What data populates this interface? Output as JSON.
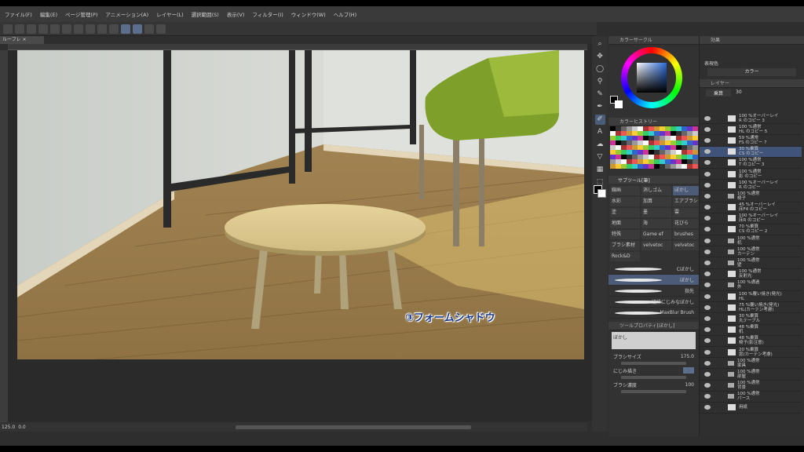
{
  "menu": [
    "ファイル(F)",
    "編集(E)",
    "ページ管理(P)",
    "アニメーション(A)",
    "レイヤー(L)",
    "選択範囲(S)",
    "表示(V)",
    "フィルター(I)",
    "ウィンドウ(W)",
    "ヘルプ(H)"
  ],
  "doc_tab": "ルーフレ",
  "caption": "③フォームシャドウ",
  "status": {
    "zoom": "125.0",
    "angle": "0.0"
  },
  "colors": {
    "accent": "#4c5c78",
    "selected_layer": "#3f5478",
    "caption": "#1a3a88"
  },
  "color_wheel_header": "カラーサークル",
  "color_history_header": "カラーヒストリー",
  "subtool_header": "サブツール[筆]",
  "subtools": [
    "線画",
    "消しゴム",
    "ぼかし",
    "水彩",
    "加算",
    "エアブラシ",
    "塗",
    "墨",
    "雲",
    "地面",
    "海",
    "花びら",
    "特殊",
    "Game ef",
    "brushes",
    "ブラシ素材",
    "velvetoc",
    "velvetoc",
    "Rock&D"
  ],
  "brushes": [
    "Cぼかし",
    "ぼかし",
    "指先",
    "繊維にじみなぼかし",
    "MaxBlur Brush"
  ],
  "tool_property_header": "ツールプロパティ[ぼかし]",
  "tool_property": {
    "name": "ぼかし",
    "size_label": "ブラシサイズ",
    "size_value": "175.0",
    "blend_label": "にじみ描き",
    "density_label": "ブラシ濃度",
    "density_value": "100"
  },
  "right_panel": {
    "effect_label": "効果",
    "expression_label": "表現色",
    "expression_value": "カラー",
    "layer_tab": "レイヤー",
    "blend_mode": "乗算",
    "opacity": "30"
  },
  "layers": [
    {
      "name": "100 %オーバーレイ\nR のコピー 3",
      "type": "img"
    },
    {
      "name": "100 %通常\nHL のコピー 5",
      "type": "img"
    },
    {
      "name": "59 %通常\nFS のコピー 7",
      "type": "img"
    },
    {
      "name": "30 %乗算\nCS のコピー",
      "type": "img",
      "selected": true
    },
    {
      "name": "100 %通常\nT のコピー 3",
      "type": "img"
    },
    {
      "name": "100 %通常\n影 のコピー",
      "type": "img"
    },
    {
      "name": "100 %オーバーレイ\nR のコピー",
      "type": "img"
    },
    {
      "name": "100 %通常\n椅子",
      "type": "folder"
    },
    {
      "name": "45 %オーバーレイ\n床F4 のコピー",
      "type": "img"
    },
    {
      "name": "100 %オーバーレイ\n床R のコピー",
      "type": "img"
    },
    {
      "name": "70 %乗算\nCS のコピー 2",
      "type": "img"
    },
    {
      "name": "100 %通常\n机",
      "type": "folder"
    },
    {
      "name": "100 %通常\nカーテン",
      "type": "folder"
    },
    {
      "name": "100 %通常\n壁",
      "type": "folder"
    },
    {
      "name": "100 %通常\n反射光",
      "type": "img"
    },
    {
      "name": "100 %通過\n外",
      "type": "folder"
    },
    {
      "name": "100 %覆い焼き(発光)\nHL",
      "type": "img"
    },
    {
      "name": "75 %覆い焼き(発光)\nHL(カーテン考慮)",
      "type": "img"
    },
    {
      "name": "30 %乗算\n丸テーブル",
      "type": "img"
    },
    {
      "name": "48 %乗算\n机",
      "type": "img"
    },
    {
      "name": "48 %乗算\n椅子(影注意)",
      "type": "img"
    },
    {
      "name": "20 %乗算\n窓(カーテン考慮)",
      "type": "img"
    },
    {
      "name": "100 %通常\n家具",
      "type": "folder"
    },
    {
      "name": "100 %通常\n部屋",
      "type": "folder"
    },
    {
      "name": "100 %通常\n背景",
      "type": "folder"
    },
    {
      "name": "100 %通常\nパース",
      "type": "folder"
    },
    {
      "name": "用紙",
      "type": "paper"
    }
  ]
}
